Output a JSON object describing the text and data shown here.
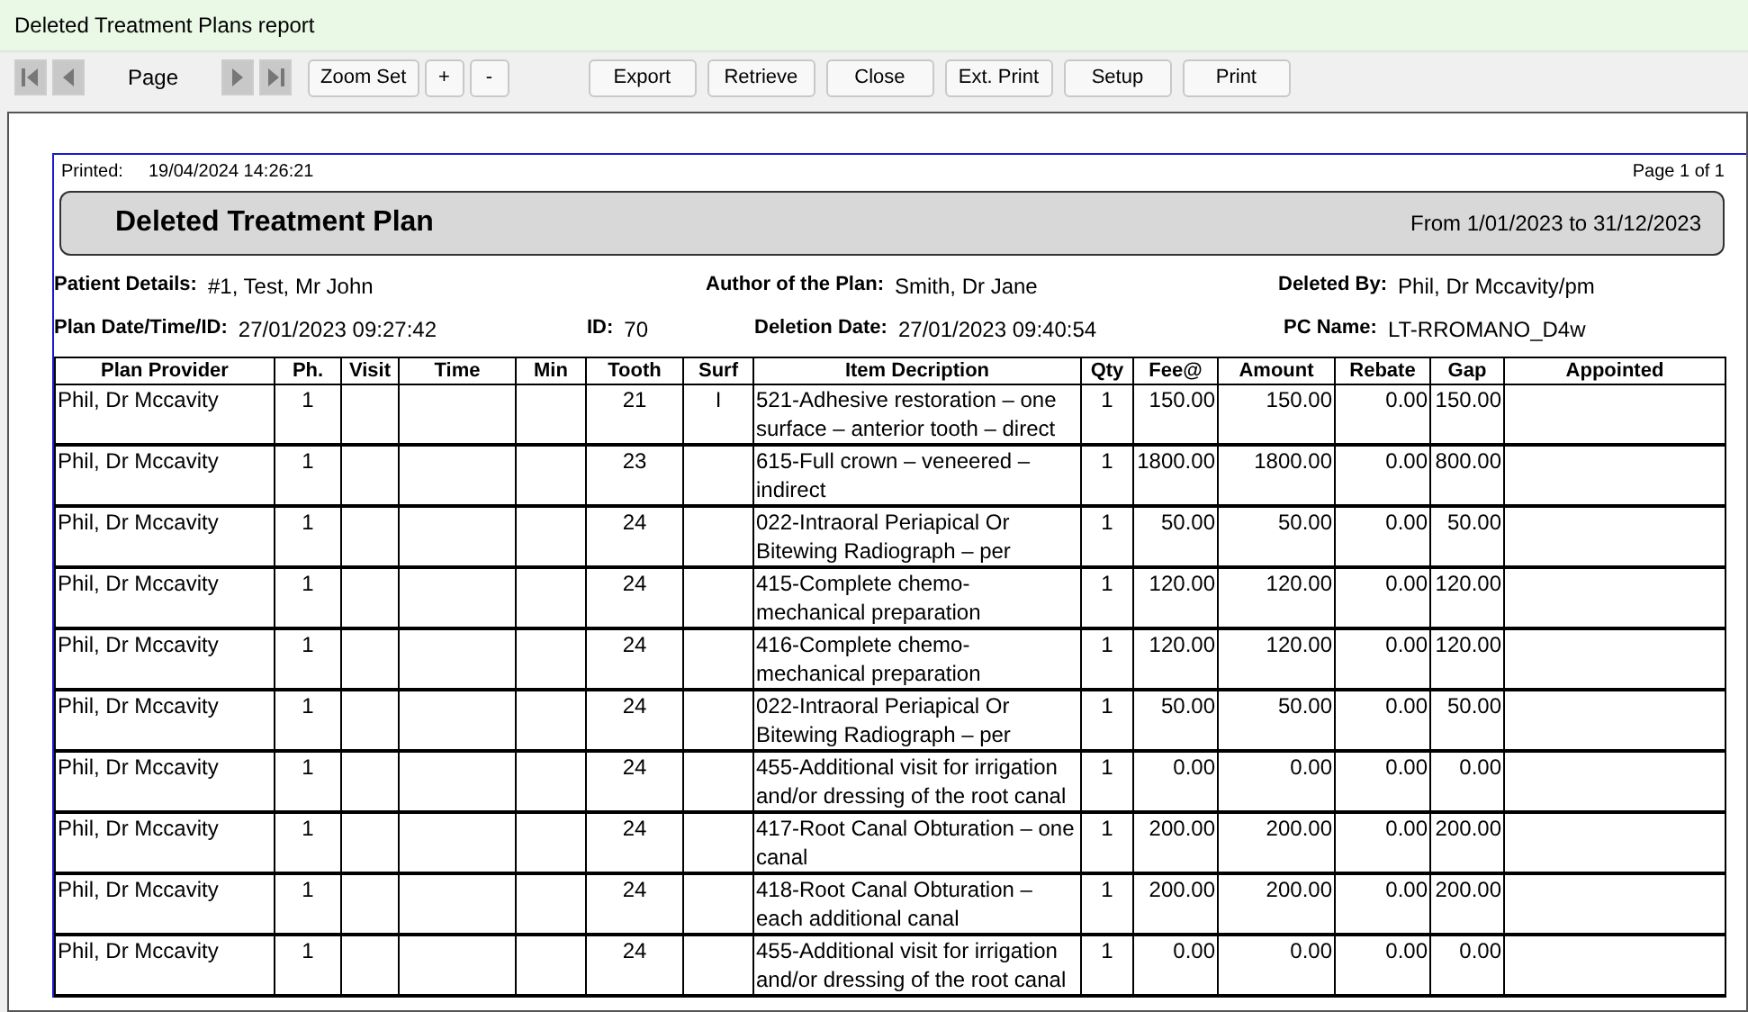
{
  "window": {
    "title": "Deleted Treatment Plans report"
  },
  "toolbar": {
    "page_label": "Page",
    "zoom_buttons": [
      "Zoom Set",
      "+",
      "-"
    ],
    "action_buttons": [
      "Export",
      "Retrieve",
      "Close",
      "Ext. Print",
      "Setup",
      "Print"
    ]
  },
  "report": {
    "printed_label": "Printed:",
    "printed_value": "19/04/2024 14:26:21",
    "page_info": "Page 1 of 1",
    "title": "Deleted Treatment Plan",
    "date_range": "From 1/01/2023 to 31/12/2023",
    "details": [
      {
        "label": "Patient Details:",
        "value": "#1, Test, Mr John"
      },
      {
        "label": "Author of the Plan:",
        "value": "Smith, Dr Jane"
      },
      {
        "label": "Deleted By:",
        "value": "Phil, Dr Mccavity/pm"
      },
      {
        "label": "Plan Date/Time/ID:",
        "value": "27/01/2023 09:27:42"
      },
      {
        "label": "ID:",
        "value": "70"
      },
      {
        "label": "Deletion Date:",
        "value": "27/01/2023 09:40:54"
      },
      {
        "label": "PC Name:",
        "value": "LT-RROMANO_D4w"
      }
    ],
    "table": {
      "columns": [
        "Plan Provider",
        "Ph.",
        "Visit",
        "Time",
        "Min",
        "Tooth",
        "Surf",
        "Item Decription",
        "Qty",
        "Fee@",
        "Amount",
        "Rebate",
        "Gap",
        "Appointed"
      ],
      "rows": [
        [
          "Phil, Dr Mccavity",
          "1",
          "",
          "",
          "",
          "21",
          "I",
          "521-Adhesive restoration – one surface – anterior tooth – direct",
          "1",
          "150.00",
          "150.00",
          "0.00",
          "150.00",
          ""
        ],
        [
          "Phil, Dr Mccavity",
          "1",
          "",
          "",
          "",
          "23",
          "",
          "615-Full crown – veneered – indirect",
          "1",
          "1800.00",
          "1800.00",
          "0.00",
          "800.00",
          ""
        ],
        [
          "Phil, Dr Mccavity",
          "1",
          "",
          "",
          "",
          "24",
          "",
          "022-Intraoral Periapical Or Bitewing Radiograph – per",
          "1",
          "50.00",
          "50.00",
          "0.00",
          "50.00",
          ""
        ],
        [
          "Phil, Dr Mccavity",
          "1",
          "",
          "",
          "",
          "24",
          "",
          "415-Complete chemo-mechanical preparation",
          "1",
          "120.00",
          "120.00",
          "0.00",
          "120.00",
          ""
        ],
        [
          "Phil, Dr Mccavity",
          "1",
          "",
          "",
          "",
          "24",
          "",
          "416-Complete chemo-mechanical preparation",
          "1",
          "120.00",
          "120.00",
          "0.00",
          "120.00",
          ""
        ],
        [
          "Phil, Dr Mccavity",
          "1",
          "",
          "",
          "",
          "24",
          "",
          "022-Intraoral Periapical Or Bitewing Radiograph – per",
          "1",
          "50.00",
          "50.00",
          "0.00",
          "50.00",
          ""
        ],
        [
          "Phil, Dr Mccavity",
          "1",
          "",
          "",
          "",
          "24",
          "",
          "455-Additional visit for irrigation and/or dressing of the root canal",
          "1",
          "0.00",
          "0.00",
          "0.00",
          "0.00",
          ""
        ],
        [
          "Phil, Dr Mccavity",
          "1",
          "",
          "",
          "",
          "24",
          "",
          "417-Root Canal Obturation  – one canal",
          "1",
          "200.00",
          "200.00",
          "0.00",
          "200.00",
          ""
        ],
        [
          "Phil, Dr Mccavity",
          "1",
          "",
          "",
          "",
          "24",
          "",
          "418-Root Canal Obturation  – each additional canal",
          "1",
          "200.00",
          "200.00",
          "0.00",
          "200.00",
          ""
        ],
        [
          "Phil, Dr Mccavity",
          "1",
          "",
          "",
          "",
          "24",
          "",
          "455-Additional visit for irrigation and/or dressing of the root canal",
          "1",
          "0.00",
          "0.00",
          "0.00",
          "0.00",
          ""
        ]
      ]
    }
  }
}
